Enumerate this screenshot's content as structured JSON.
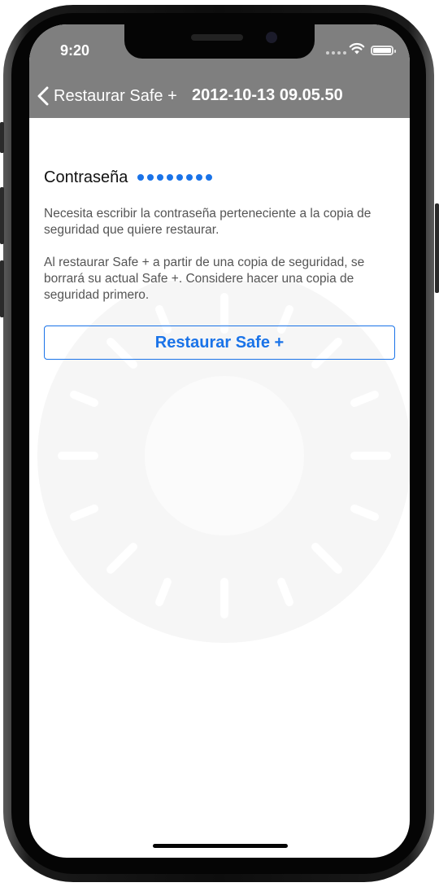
{
  "status_bar": {
    "time": "9:20"
  },
  "nav": {
    "back_label": "Restaurar Safe +",
    "title": "2012-10-13 09.05.50"
  },
  "form": {
    "password_label": "Contraseña",
    "password_mask_count": 8
  },
  "help": {
    "paragraph1": "Necesita escribir la contraseña perteneciente a la copia de seguridad que quiere restaurar.",
    "paragraph2": "Al restaurar Safe + a partir de una copia de seguridad, se borrará su actual Safe +. Considere hacer una copia de seguridad primero."
  },
  "actions": {
    "restore_label": "Restaurar Safe +"
  },
  "colors": {
    "accent": "#1a73e8",
    "navbar": "#7f7f7f"
  }
}
